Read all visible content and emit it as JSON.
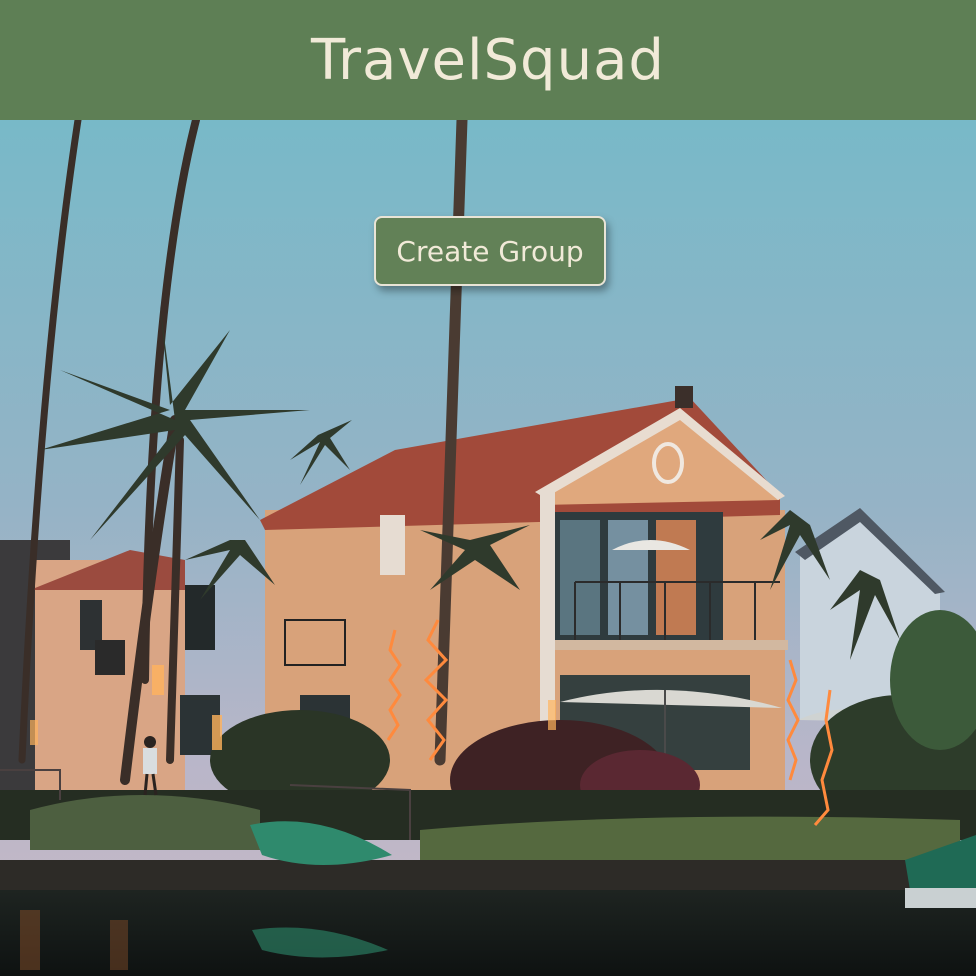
{
  "header": {
    "app_title": "TravelSquad"
  },
  "hero": {
    "create_group_label": "Create Group"
  },
  "colors": {
    "header_bg": "#5e7f55",
    "button_bg": "#628157",
    "title_text": "#f1ead8"
  }
}
